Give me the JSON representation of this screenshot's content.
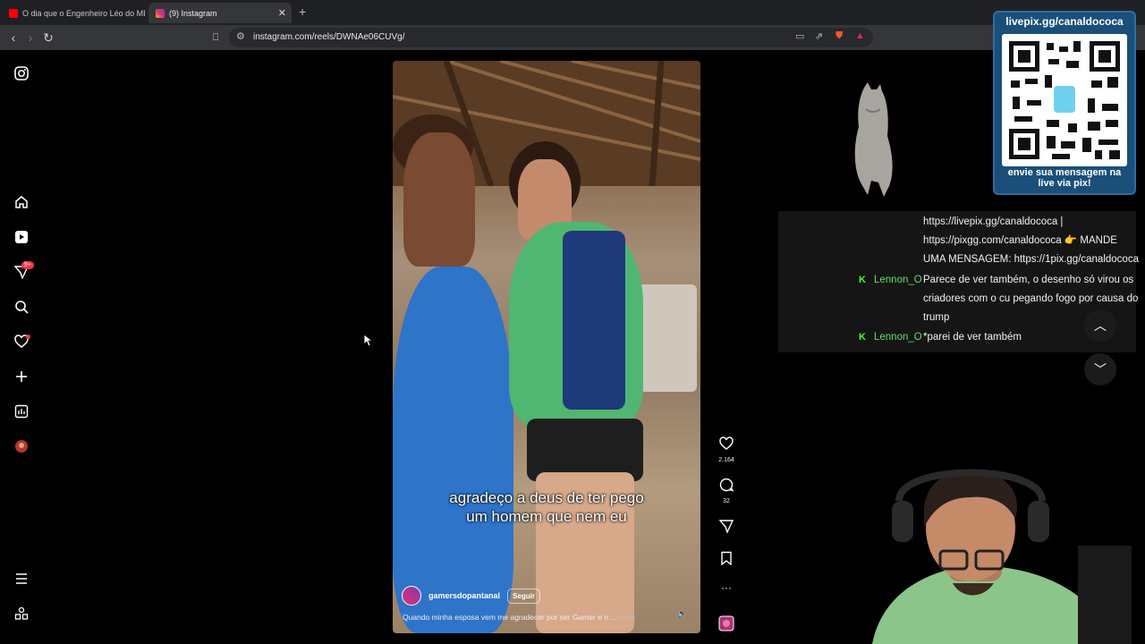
{
  "browser": {
    "tabs": [
      {
        "title": "O dia que o Engenheiro Léo do MBL",
        "icon": "youtube-icon"
      },
      {
        "title": "(9) Instagram",
        "icon": "instagram-icon"
      }
    ],
    "address": "instagram.com/reels/DWNAe06CUVg/"
  },
  "nav": {
    "notification_badge": "9+",
    "items": [
      "instagram-logo",
      "home",
      "reels",
      "direct-messages",
      "search",
      "notifications",
      "create",
      "dashboard",
      "profile",
      "more",
      "also-from-meta"
    ]
  },
  "reel": {
    "caption_line1": "agradeço a deus de ter pego",
    "caption_line2": "um homem que nem eu",
    "author": "gamersdopantanal",
    "follow_label": "Seguir",
    "description": "Quando minha esposa vem me agradecer por ser Gamer e n ...",
    "more_label": "mais",
    "likes": "2.164",
    "comments": "32"
  },
  "overlay": {
    "qr_title": "livepix.gg/canaldococa",
    "qr_footer_line1": "envie sua mensagem na",
    "qr_footer_line2": "live via pix!"
  },
  "chat": {
    "pinned_line1": "https://livepix.gg/canaldococa |",
    "pinned_line2": "https://pixgg.com/canaldococa 👉 MANDE",
    "pinned_line3": "UMA MENSAGEM: https://1pix.gg/canaldococa",
    "messages": [
      {
        "user": "Lennon_O",
        "line1": "Parece de ver também, o desenho só virou os",
        "line2": "criadores com o cu pegando fogo por causa do",
        "line3": "trump"
      },
      {
        "user": "Lennon_O",
        "line1": "*parei de ver também"
      }
    ],
    "badge_letter": "K"
  },
  "colors": {
    "accent_red": "#ff3040",
    "chat_user": "#5fdd6b",
    "qr_bg": "#1a4f7a"
  }
}
